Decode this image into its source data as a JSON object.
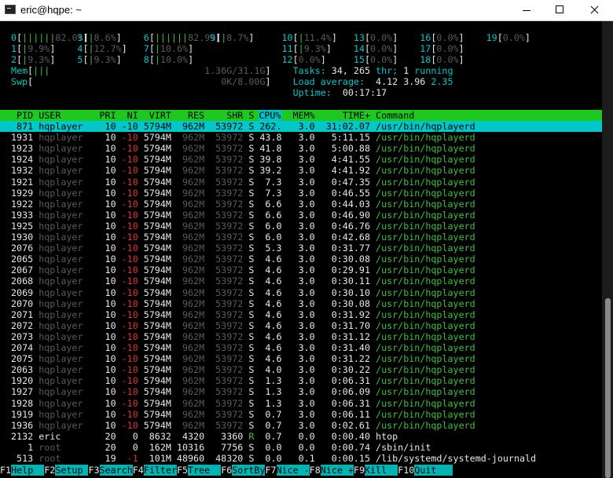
{
  "window": {
    "title": "eric@hqpe: ~",
    "icon": "terminal-icon"
  },
  "meters": [
    {
      "id": "0",
      "pct": "82.0%",
      "bars": "||||||"
    },
    {
      "id": "1",
      "pct": "9.9%",
      "bars": "|"
    },
    {
      "id": "2",
      "pct": "9.3%",
      "bars": "|"
    },
    {
      "id": "3",
      "pct": "8.6%",
      "bars": "|"
    },
    {
      "id": "4",
      "pct": "12.7%",
      "bars": "|"
    },
    {
      "id": "5",
      "pct": "9.3%",
      "bars": "|"
    },
    {
      "id": "6",
      "pct": "82.9%",
      "bars": "||||||"
    },
    {
      "id": "7",
      "pct": "10.6%",
      "bars": "|"
    },
    {
      "id": "8",
      "pct": "10.0%",
      "bars": "|"
    },
    {
      "id": "9",
      "pct": "8.7%",
      "bars": "|"
    },
    {
      "id": "10",
      "pct": "11.4%",
      "bars": "|"
    },
    {
      "id": "11",
      "pct": "9.3%",
      "bars": "|"
    },
    {
      "id": "12",
      "pct": "0.0%",
      "bars": ""
    },
    {
      "id": "13",
      "pct": "0.0%",
      "bars": ""
    },
    {
      "id": "14",
      "pct": "0.0%",
      "bars": ""
    },
    {
      "id": "15",
      "pct": "0.0%",
      "bars": ""
    },
    {
      "id": "16",
      "pct": "0.0%",
      "bars": ""
    },
    {
      "id": "17",
      "pct": "0.0%",
      "bars": ""
    },
    {
      "id": "18",
      "pct": "0.0%",
      "bars": ""
    },
    {
      "id": "19",
      "pct": "0.0%",
      "bars": ""
    }
  ],
  "memory": {
    "mem_label": "Mem",
    "mem_bars": "|||",
    "mem_value": "1.36G/31.1G",
    "swp_label": "Swp",
    "swp_bars": "",
    "swp_value": "0K/8.00G"
  },
  "summary": {
    "tasks_label": "Tasks:",
    "tasks_value": "34,",
    "thr_value": "265",
    "thr_label": "thr;",
    "running_value": "1",
    "running_label": "running",
    "load_label": "Load average:",
    "load1": "4.12",
    "load5": "3.96",
    "load15": "2.35",
    "uptime_label": "Uptime:",
    "uptime_value": "00:17:17"
  },
  "columns": [
    "PID",
    "USER",
    "PRI",
    "NI",
    "VIRT",
    "RES",
    "SHR",
    "S",
    "CPU%",
    "MEM%",
    "TIME+",
    "Command"
  ],
  "processes": [
    {
      "pid": "871",
      "user": "hqplayer",
      "pri": "10",
      "ni": "-10",
      "virt": "5794M",
      "res": "962M",
      "shr": "53972",
      "s": "S",
      "cpu": "262.",
      "mem": "3.0",
      "time": "31:02.07",
      "cmd": "/usr/bin/hqplayerd"
    },
    {
      "pid": "1931",
      "user": "hqplayer",
      "pri": "10",
      "ni": "-10",
      "virt": "5794M",
      "res": "962M",
      "shr": "53972",
      "s": "S",
      "cpu": "43.8",
      "mem": "3.0",
      "time": "5:11.15",
      "cmd": "/usr/bin/hqplayerd"
    },
    {
      "pid": "1923",
      "user": "hqplayer",
      "pri": "10",
      "ni": "-10",
      "virt": "5794M",
      "res": "962M",
      "shr": "53972",
      "s": "S",
      "cpu": "41.8",
      "mem": "3.0",
      "time": "5:00.88",
      "cmd": "/usr/bin/hqplayerd"
    },
    {
      "pid": "1924",
      "user": "hqplayer",
      "pri": "10",
      "ni": "-10",
      "virt": "5794M",
      "res": "962M",
      "shr": "53972",
      "s": "S",
      "cpu": "39.8",
      "mem": "3.0",
      "time": "4:41.55",
      "cmd": "/usr/bin/hqplayerd"
    },
    {
      "pid": "1932",
      "user": "hqplayer",
      "pri": "10",
      "ni": "-10",
      "virt": "5794M",
      "res": "962M",
      "shr": "53972",
      "s": "S",
      "cpu": "39.2",
      "mem": "3.0",
      "time": "4:41.92",
      "cmd": "/usr/bin/hqplayerd"
    },
    {
      "pid": "1921",
      "user": "hqplayer",
      "pri": "10",
      "ni": "-10",
      "virt": "5794M",
      "res": "962M",
      "shr": "53972",
      "s": "S",
      "cpu": "7.3",
      "mem": "3.0",
      "time": "0:47.35",
      "cmd": "/usr/bin/hqplayerd"
    },
    {
      "pid": "1929",
      "user": "hqplayer",
      "pri": "10",
      "ni": "-10",
      "virt": "5794M",
      "res": "962M",
      "shr": "53972",
      "s": "S",
      "cpu": "7.3",
      "mem": "3.0",
      "time": "0:46.55",
      "cmd": "/usr/bin/hqplayerd"
    },
    {
      "pid": "1922",
      "user": "hqplayer",
      "pri": "10",
      "ni": "-10",
      "virt": "5794M",
      "res": "962M",
      "shr": "53972",
      "s": "S",
      "cpu": "6.6",
      "mem": "3.0",
      "time": "0:44.03",
      "cmd": "/usr/bin/hqplayerd"
    },
    {
      "pid": "1933",
      "user": "hqplayer",
      "pri": "10",
      "ni": "-10",
      "virt": "5794M",
      "res": "962M",
      "shr": "53972",
      "s": "S",
      "cpu": "6.6",
      "mem": "3.0",
      "time": "0:46.90",
      "cmd": "/usr/bin/hqplayerd"
    },
    {
      "pid": "1925",
      "user": "hqplayer",
      "pri": "10",
      "ni": "-10",
      "virt": "5794M",
      "res": "962M",
      "shr": "53972",
      "s": "S",
      "cpu": "6.0",
      "mem": "3.0",
      "time": "0:46.76",
      "cmd": "/usr/bin/hqplayerd"
    },
    {
      "pid": "1930",
      "user": "hqplayer",
      "pri": "10",
      "ni": "-10",
      "virt": "5794M",
      "res": "962M",
      "shr": "53972",
      "s": "S",
      "cpu": "6.0",
      "mem": "3.0",
      "time": "0:42.68",
      "cmd": "/usr/bin/hqplayerd"
    },
    {
      "pid": "2076",
      "user": "hqplayer",
      "pri": "10",
      "ni": "-10",
      "virt": "5794M",
      "res": "962M",
      "shr": "53972",
      "s": "S",
      "cpu": "5.3",
      "mem": "3.0",
      "time": "0:31.77",
      "cmd": "/usr/bin/hqplayerd"
    },
    {
      "pid": "2065",
      "user": "hqplayer",
      "pri": "10",
      "ni": "-10",
      "virt": "5794M",
      "res": "962M",
      "shr": "53972",
      "s": "S",
      "cpu": "4.6",
      "mem": "3.0",
      "time": "0:30.08",
      "cmd": "/usr/bin/hqplayerd"
    },
    {
      "pid": "2067",
      "user": "hqplayer",
      "pri": "10",
      "ni": "-10",
      "virt": "5794M",
      "res": "962M",
      "shr": "53972",
      "s": "S",
      "cpu": "4.6",
      "mem": "3.0",
      "time": "0:29.91",
      "cmd": "/usr/bin/hqplayerd"
    },
    {
      "pid": "2068",
      "user": "hqplayer",
      "pri": "10",
      "ni": "-10",
      "virt": "5794M",
      "res": "962M",
      "shr": "53972",
      "s": "S",
      "cpu": "4.6",
      "mem": "3.0",
      "time": "0:30.11",
      "cmd": "/usr/bin/hqplayerd"
    },
    {
      "pid": "2069",
      "user": "hqplayer",
      "pri": "10",
      "ni": "-10",
      "virt": "5794M",
      "res": "962M",
      "shr": "53972",
      "s": "S",
      "cpu": "4.6",
      "mem": "3.0",
      "time": "0:30.10",
      "cmd": "/usr/bin/hqplayerd"
    },
    {
      "pid": "2070",
      "user": "hqplayer",
      "pri": "10",
      "ni": "-10",
      "virt": "5794M",
      "res": "962M",
      "shr": "53972",
      "s": "S",
      "cpu": "4.6",
      "mem": "3.0",
      "time": "0:30.08",
      "cmd": "/usr/bin/hqplayerd"
    },
    {
      "pid": "2071",
      "user": "hqplayer",
      "pri": "10",
      "ni": "-10",
      "virt": "5794M",
      "res": "962M",
      "shr": "53972",
      "s": "S",
      "cpu": "4.6",
      "mem": "3.0",
      "time": "0:31.92",
      "cmd": "/usr/bin/hqplayerd"
    },
    {
      "pid": "2072",
      "user": "hqplayer",
      "pri": "10",
      "ni": "-10",
      "virt": "5794M",
      "res": "962M",
      "shr": "53972",
      "s": "S",
      "cpu": "4.6",
      "mem": "3.0",
      "time": "0:31.70",
      "cmd": "/usr/bin/hqplayerd"
    },
    {
      "pid": "2073",
      "user": "hqplayer",
      "pri": "10",
      "ni": "-10",
      "virt": "5794M",
      "res": "962M",
      "shr": "53972",
      "s": "S",
      "cpu": "4.6",
      "mem": "3.0",
      "time": "0:31.12",
      "cmd": "/usr/bin/hqplayerd"
    },
    {
      "pid": "2074",
      "user": "hqplayer",
      "pri": "10",
      "ni": "-10",
      "virt": "5794M",
      "res": "962M",
      "shr": "53972",
      "s": "S",
      "cpu": "4.6",
      "mem": "3.0",
      "time": "0:31.40",
      "cmd": "/usr/bin/hqplayerd"
    },
    {
      "pid": "2075",
      "user": "hqplayer",
      "pri": "10",
      "ni": "-10",
      "virt": "5794M",
      "res": "962M",
      "shr": "53972",
      "s": "S",
      "cpu": "4.6",
      "mem": "3.0",
      "time": "0:31.22",
      "cmd": "/usr/bin/hqplayerd"
    },
    {
      "pid": "2063",
      "user": "hqplayer",
      "pri": "10",
      "ni": "-10",
      "virt": "5794M",
      "res": "962M",
      "shr": "53972",
      "s": "S",
      "cpu": "4.0",
      "mem": "3.0",
      "time": "0:30.22",
      "cmd": "/usr/bin/hqplayerd"
    },
    {
      "pid": "1920",
      "user": "hqplayer",
      "pri": "10",
      "ni": "-10",
      "virt": "5794M",
      "res": "962M",
      "shr": "53972",
      "s": "S",
      "cpu": "1.3",
      "mem": "3.0",
      "time": "0:06.31",
      "cmd": "/usr/bin/hqplayerd"
    },
    {
      "pid": "1927",
      "user": "hqplayer",
      "pri": "10",
      "ni": "-10",
      "virt": "5794M",
      "res": "962M",
      "shr": "53972",
      "s": "S",
      "cpu": "1.3",
      "mem": "3.0",
      "time": "0:06.09",
      "cmd": "/usr/bin/hqplayerd"
    },
    {
      "pid": "1928",
      "user": "hqplayer",
      "pri": "10",
      "ni": "-10",
      "virt": "5794M",
      "res": "962M",
      "shr": "53972",
      "s": "S",
      "cpu": "1.3",
      "mem": "3.0",
      "time": "0:06.31",
      "cmd": "/usr/bin/hqplayerd"
    },
    {
      "pid": "1919",
      "user": "hqplayer",
      "pri": "10",
      "ni": "-10",
      "virt": "5794M",
      "res": "962M",
      "shr": "53972",
      "s": "S",
      "cpu": "0.7",
      "mem": "3.0",
      "time": "0:06.11",
      "cmd": "/usr/bin/hqplayerd"
    },
    {
      "pid": "1936",
      "user": "hqplayer",
      "pri": "10",
      "ni": "-10",
      "virt": "5794M",
      "res": "962M",
      "shr": "53972",
      "s": "S",
      "cpu": "0.7",
      "mem": "3.0",
      "time": "0:02.61",
      "cmd": "/usr/bin/hqplayerd"
    },
    {
      "pid": "2132",
      "user": "eric",
      "pri": "20",
      "ni": "0",
      "virt": "8632",
      "res": "4320",
      "shr": "3360",
      "s": "R",
      "cpu": "0.7",
      "mem": "0.0",
      "time": "0:00.40",
      "cmd": "htop"
    },
    {
      "pid": "1",
      "user": "root",
      "pri": "20",
      "ni": "0",
      "virt": "162M",
      "res": "10316",
      "shr": "7756",
      "s": "S",
      "cpu": "0.0",
      "mem": "0.0",
      "time": "0:00.74",
      "cmd": "/sbin/init"
    },
    {
      "pid": "513",
      "user": "root",
      "pri": "19",
      "ni": "-1",
      "virt": "101M",
      "res": "48960",
      "shr": "48320",
      "s": "S",
      "cpu": "0.0",
      "mem": "0.1",
      "time": "0:00.15",
      "cmd": "/lib/systemd/systemd-journald"
    }
  ],
  "function_keys": [
    {
      "key": "F1",
      "label": "Help"
    },
    {
      "key": "F2",
      "label": "Setup"
    },
    {
      "key": "F3",
      "label": "Search"
    },
    {
      "key": "F4",
      "label": "Filter"
    },
    {
      "key": "F5",
      "label": "Tree"
    },
    {
      "key": "F6",
      "label": "SortBy"
    },
    {
      "key": "F7",
      "label": "Nice -"
    },
    {
      "key": "F8",
      "label": "Nice +"
    },
    {
      "key": "F9",
      "label": "Kill"
    },
    {
      "key": "F10",
      "label": "Quit"
    }
  ],
  "colors": {
    "header_bg": "#1ec81e",
    "cursor_row_bg": "#00c8c8",
    "cpu_header_bg": "#00c4c4",
    "negative_nice": "#e03030",
    "dim_text": "#5a5a5a",
    "fkey_label_bg": "#00b4b4"
  }
}
